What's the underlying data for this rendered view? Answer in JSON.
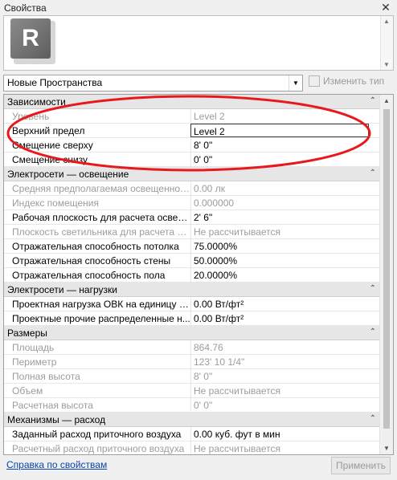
{
  "window": {
    "title": "Свойства",
    "close_label": "✕"
  },
  "preview": {
    "logo_letter": "R"
  },
  "type_selector": {
    "value": "Новые Пространства",
    "edit_type_label": "Изменить тип"
  },
  "sections": [
    {
      "title": "Зависимости",
      "rows": [
        {
          "name": "Уровень",
          "value": "Level 2",
          "readonly": true
        },
        {
          "name": "Верхний предел",
          "value": "Level 2",
          "readonly": false,
          "editing": true
        },
        {
          "name": "Смещение сверху",
          "value": "8'  0\"",
          "readonly": false
        },
        {
          "name": "Смещение снизу",
          "value": "0'  0\"",
          "readonly": false
        }
      ]
    },
    {
      "title": "Электросети — освещение",
      "rows": [
        {
          "name": "Средняя предполагаемая освещенность",
          "value": "0.00 лк",
          "readonly": true
        },
        {
          "name": "Индекс помещения",
          "value": "0.000000",
          "readonly": true
        },
        {
          "name": "Рабочая плоскость для расчета освещ...",
          "value": "2'  6\"",
          "readonly": false
        },
        {
          "name": "Плоскость светильника для расчета о...",
          "value": "Не рассчитывается",
          "readonly": true
        },
        {
          "name": "Отражательная способность потолка",
          "value": "75.0000%",
          "readonly": false
        },
        {
          "name": "Отражательная способность стены",
          "value": "50.0000%",
          "readonly": false
        },
        {
          "name": "Отражательная способность пола",
          "value": "20.0000%",
          "readonly": false
        }
      ]
    },
    {
      "title": "Электросети — нагрузки",
      "rows": [
        {
          "name": "Проектная нагрузка ОВК на единицу п...",
          "value": "0.00 Вт/фт²",
          "readonly": false
        },
        {
          "name": "Проектные прочие распределенные н...",
          "value": "0.00 Вт/фт²",
          "readonly": false
        }
      ]
    },
    {
      "title": "Размеры",
      "rows": [
        {
          "name": "Площадь",
          "value": "864.76",
          "readonly": true
        },
        {
          "name": "Периметр",
          "value": "123'  10 1/4\"",
          "readonly": true
        },
        {
          "name": "Полная высота",
          "value": "8'  0\"",
          "readonly": true
        },
        {
          "name": "Объем",
          "value": "Не рассчитывается",
          "readonly": true
        },
        {
          "name": "Расчетная высота",
          "value": "0'  0\"",
          "readonly": true
        }
      ]
    },
    {
      "title": "Механизмы — расход",
      "rows": [
        {
          "name": "Заданный расход приточного воздуха",
          "value": "0.00 куб. фут в мин",
          "readonly": false
        },
        {
          "name": "Расчетный расход приточного воздуха",
          "value": "Не рассчитывается",
          "readonly": true
        }
      ]
    }
  ],
  "footer": {
    "help_link": "Справка по свойствам",
    "apply_label": "Применить"
  },
  "colors": {
    "annotation_oval": "#e8191c",
    "link": "#0645ad"
  }
}
